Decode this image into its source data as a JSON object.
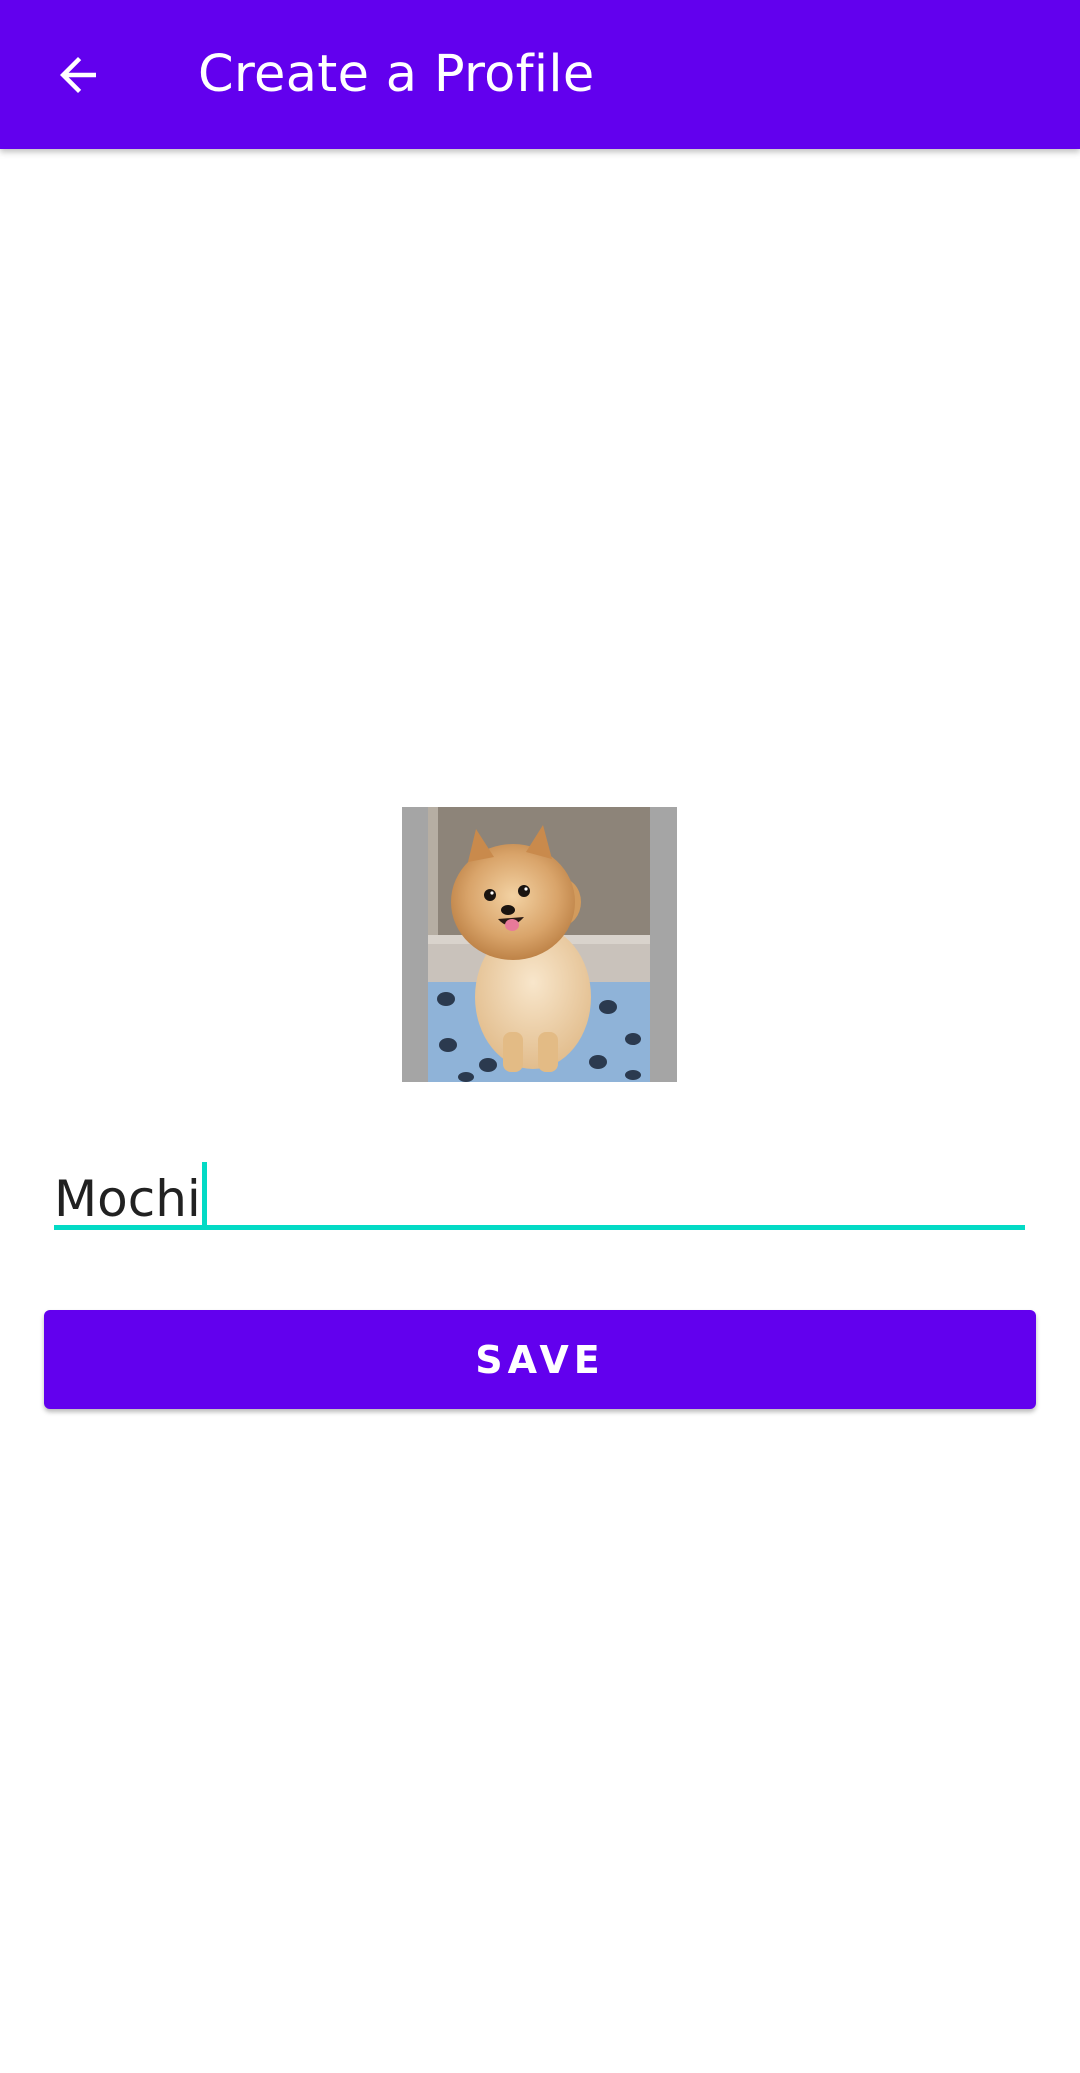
{
  "app_bar": {
    "title": "Create a Profile",
    "back_icon": "arrow-back-icon",
    "background_color": "#6200ee"
  },
  "profile": {
    "photo_subject": "pomeranian dog photo",
    "name_value": "Mochi",
    "field_accent_color": "#03dac5"
  },
  "actions": {
    "save_label": "SAVE",
    "button_color": "#6200ee"
  }
}
